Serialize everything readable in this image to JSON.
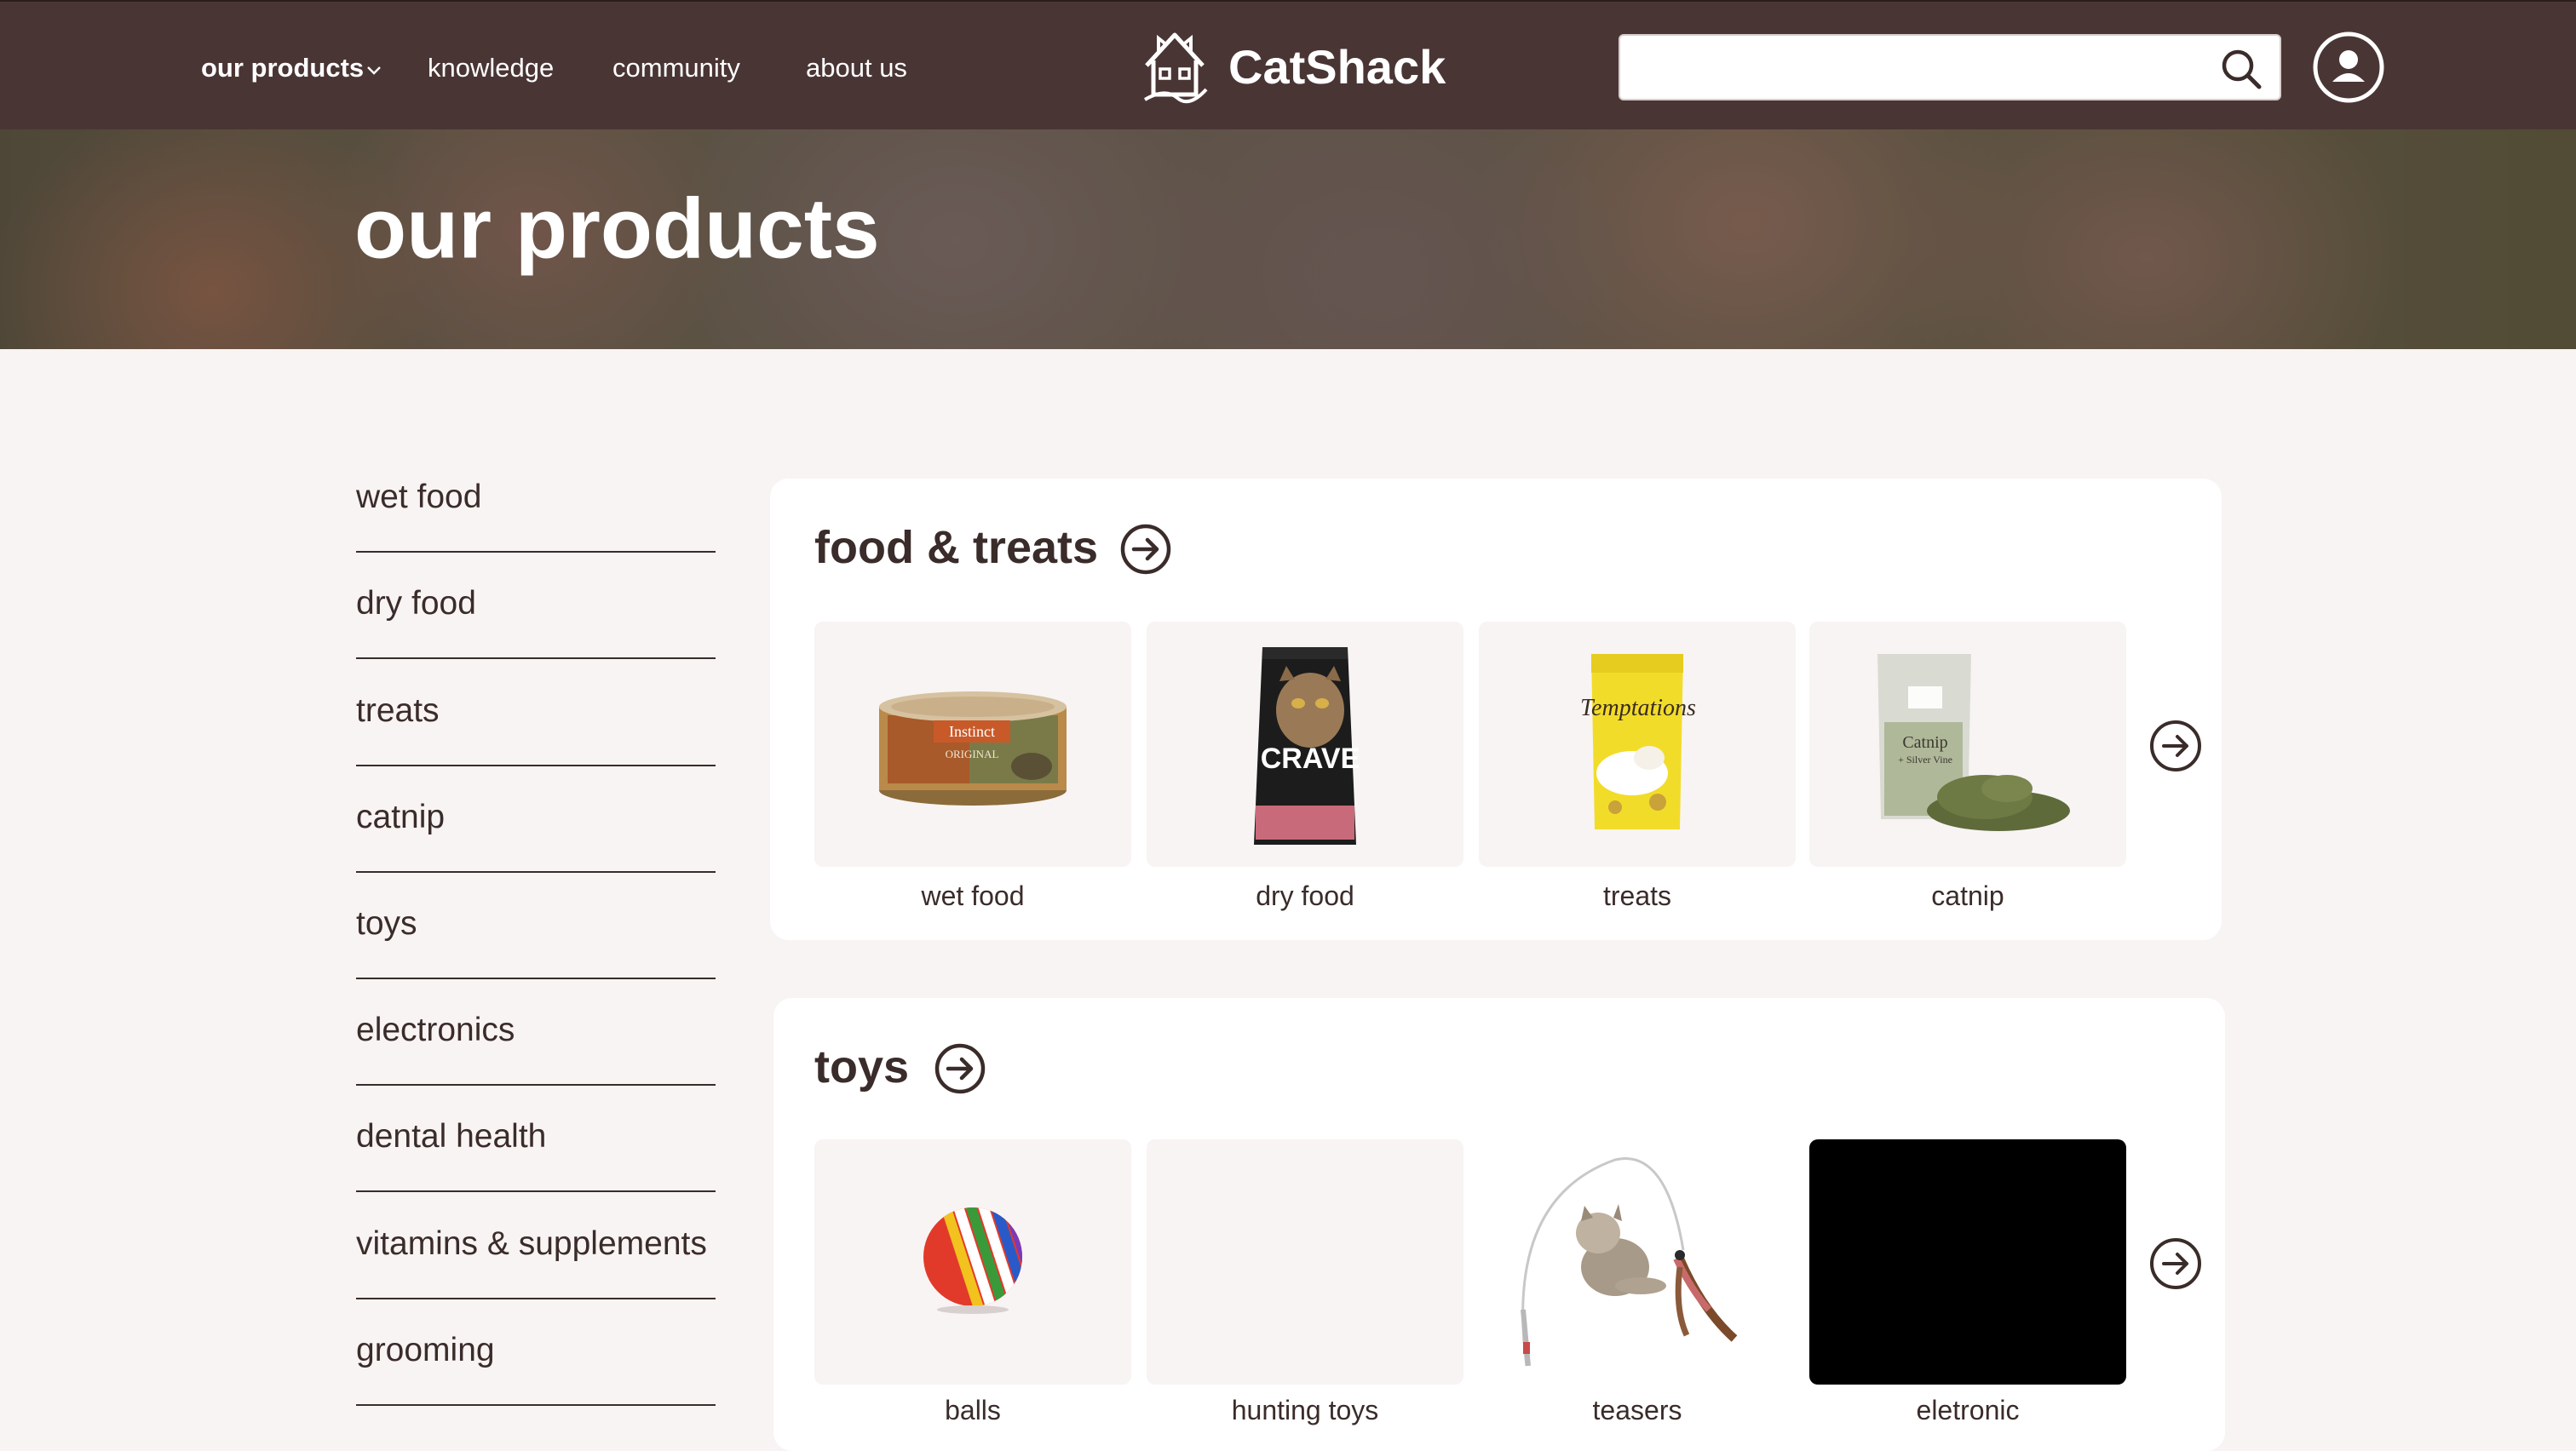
{
  "header": {
    "nav": [
      {
        "label": "our products",
        "active": true
      },
      {
        "label": "knowledge"
      },
      {
        "label": "community"
      },
      {
        "label": "about us"
      }
    ],
    "brand": "CatShack",
    "search": {
      "value": "",
      "placeholder": ""
    },
    "icons": {
      "search": "search-icon",
      "account": "account-icon",
      "logo": "cat-house-logo"
    }
  },
  "hero": {
    "title": "our products"
  },
  "sidebar": {
    "items": [
      {
        "label": "wet food"
      },
      {
        "label": "dry food"
      },
      {
        "label": "treats"
      },
      {
        "label": "catnip"
      },
      {
        "label": "toys"
      },
      {
        "label": "electronics"
      },
      {
        "label": "dental health"
      },
      {
        "label": "vitamins & supplements"
      },
      {
        "label": "grooming"
      }
    ]
  },
  "sections": [
    {
      "title": "food & treats",
      "items": [
        {
          "label": "wet food"
        },
        {
          "label": "dry food"
        },
        {
          "label": "treats"
        },
        {
          "label": "catnip"
        }
      ]
    },
    {
      "title": "toys",
      "items": [
        {
          "label": "balls"
        },
        {
          "label": "hunting toys"
        },
        {
          "label": "teasers"
        },
        {
          "label": "eletronic"
        }
      ]
    }
  ],
  "product_images": {
    "wet_food": {
      "brand": "Instinct",
      "line": "ORIGINAL"
    },
    "dry_food": {
      "brand": "CRAVE"
    },
    "treats": {
      "brand": "Temptations"
    },
    "catnip": {
      "brand": "Catnip",
      "sub": "+ Silver Vine"
    }
  },
  "colors": {
    "header_bg": "#4a3535",
    "page_bg": "#f8f4f3",
    "text": "#3a2c2a"
  }
}
